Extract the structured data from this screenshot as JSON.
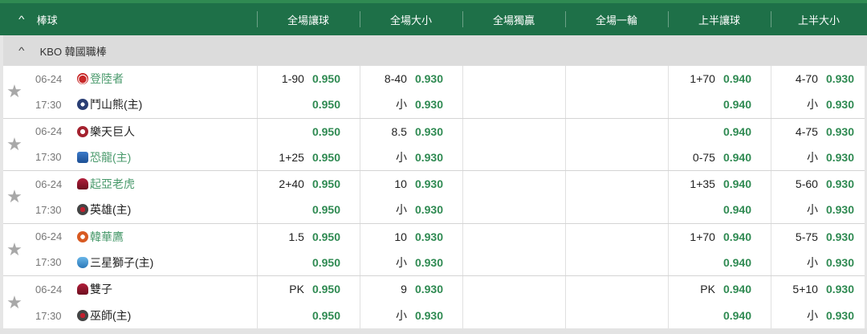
{
  "header": {
    "sport": "棒球",
    "columns": [
      "全場讓球",
      "全場大小",
      "全場獨贏",
      "全場一輪",
      "上半讓球",
      "上半大小"
    ]
  },
  "league": {
    "name": "KBO 韓國職棒"
  },
  "matches": [
    {
      "date": "06-24",
      "time": "17:30",
      "away": {
        "name": "登陸者",
        "logo": "l-red"
      },
      "home": {
        "name": "鬥山熊(主)",
        "logo": "l-navy"
      },
      "odds": [
        [
          {
            "line": "1-90",
            "price": "0.950"
          },
          {
            "line": "",
            "price": "0.950"
          }
        ],
        [
          {
            "line": "8-40",
            "price": "0.930"
          },
          {
            "line": "小",
            "price": "0.930"
          }
        ],
        [
          {
            "line": "",
            "price": ""
          },
          {
            "line": "",
            "price": ""
          }
        ],
        [
          {
            "line": "",
            "price": ""
          },
          {
            "line": "",
            "price": ""
          }
        ],
        [
          {
            "line": "1+70",
            "price": "0.940"
          },
          {
            "line": "",
            "price": "0.940"
          }
        ],
        [
          {
            "line": "4-70",
            "price": "0.930"
          },
          {
            "line": "小",
            "price": "0.930"
          }
        ]
      ]
    },
    {
      "date": "06-24",
      "time": "17:30",
      "away": {
        "name": "樂天巨人",
        "logo": "l-crimson",
        "plain": true
      },
      "home": {
        "name": "恐龍(主)",
        "logo": "l-blue",
        "green": true
      },
      "odds": [
        [
          {
            "line": "",
            "price": "0.950"
          },
          {
            "line": "1+25",
            "price": "0.950"
          }
        ],
        [
          {
            "line": "8.5",
            "price": "0.930"
          },
          {
            "line": "小",
            "price": "0.930"
          }
        ],
        [
          {
            "line": "",
            "price": ""
          },
          {
            "line": "",
            "price": ""
          }
        ],
        [
          {
            "line": "",
            "price": ""
          },
          {
            "line": "",
            "price": ""
          }
        ],
        [
          {
            "line": "",
            "price": "0.940"
          },
          {
            "line": "0-75",
            "price": "0.940"
          }
        ],
        [
          {
            "line": "4-75",
            "price": "0.930"
          },
          {
            "line": "小",
            "price": "0.930"
          }
        ]
      ]
    },
    {
      "date": "06-24",
      "time": "17:30",
      "away": {
        "name": "起亞老虎",
        "logo": "l-maroon"
      },
      "home": {
        "name": "英雄(主)",
        "logo": "l-dark"
      },
      "odds": [
        [
          {
            "line": "2+40",
            "price": "0.950"
          },
          {
            "line": "",
            "price": "0.950"
          }
        ],
        [
          {
            "line": "10",
            "price": "0.930"
          },
          {
            "line": "小",
            "price": "0.930"
          }
        ],
        [
          {
            "line": "",
            "price": ""
          },
          {
            "line": "",
            "price": ""
          }
        ],
        [
          {
            "line": "",
            "price": ""
          },
          {
            "line": "",
            "price": ""
          }
        ],
        [
          {
            "line": "1+35",
            "price": "0.940"
          },
          {
            "line": "",
            "price": "0.940"
          }
        ],
        [
          {
            "line": "5-60",
            "price": "0.930"
          },
          {
            "line": "小",
            "price": "0.930"
          }
        ]
      ]
    },
    {
      "date": "06-24",
      "time": "17:30",
      "away": {
        "name": "韓華鷹",
        "logo": "l-orange"
      },
      "home": {
        "name": "三星獅子(主)",
        "logo": "l-sky"
      },
      "odds": [
        [
          {
            "line": "1.5",
            "price": "0.950"
          },
          {
            "line": "",
            "price": "0.950"
          }
        ],
        [
          {
            "line": "10",
            "price": "0.930"
          },
          {
            "line": "小",
            "price": "0.930"
          }
        ],
        [
          {
            "line": "",
            "price": ""
          },
          {
            "line": "",
            "price": ""
          }
        ],
        [
          {
            "line": "",
            "price": ""
          },
          {
            "line": "",
            "price": ""
          }
        ],
        [
          {
            "line": "1+70",
            "price": "0.940"
          },
          {
            "line": "",
            "price": "0.940"
          }
        ],
        [
          {
            "line": "5-75",
            "price": "0.930"
          },
          {
            "line": "小",
            "price": "0.930"
          }
        ]
      ]
    },
    {
      "date": "06-24",
      "time": "17:30",
      "away": {
        "name": "雙子",
        "logo": "l-maroon",
        "plain": true
      },
      "home": {
        "name": "巫師(主)",
        "logo": "l-dark"
      },
      "odds": [
        [
          {
            "line": "PK",
            "price": "0.950"
          },
          {
            "line": "",
            "price": "0.950"
          }
        ],
        [
          {
            "line": "9",
            "price": "0.930"
          },
          {
            "line": "小",
            "price": "0.930"
          }
        ],
        [
          {
            "line": "",
            "price": ""
          },
          {
            "line": "",
            "price": ""
          }
        ],
        [
          {
            "line": "",
            "price": ""
          },
          {
            "line": "",
            "price": ""
          }
        ],
        [
          {
            "line": "PK",
            "price": "0.940"
          },
          {
            "line": "",
            "price": "0.940"
          }
        ],
        [
          {
            "line": "5+10",
            "price": "0.930"
          },
          {
            "line": "小",
            "price": "0.930"
          }
        ]
      ]
    }
  ],
  "colors": {
    "header_bg": "#1e7048",
    "price": "#2f8a52",
    "away_team": "#4a9a6c",
    "star": "#a8a8a8"
  },
  "icons": {
    "collapse": "chevron-up-icon",
    "favorite": "star-icon"
  }
}
